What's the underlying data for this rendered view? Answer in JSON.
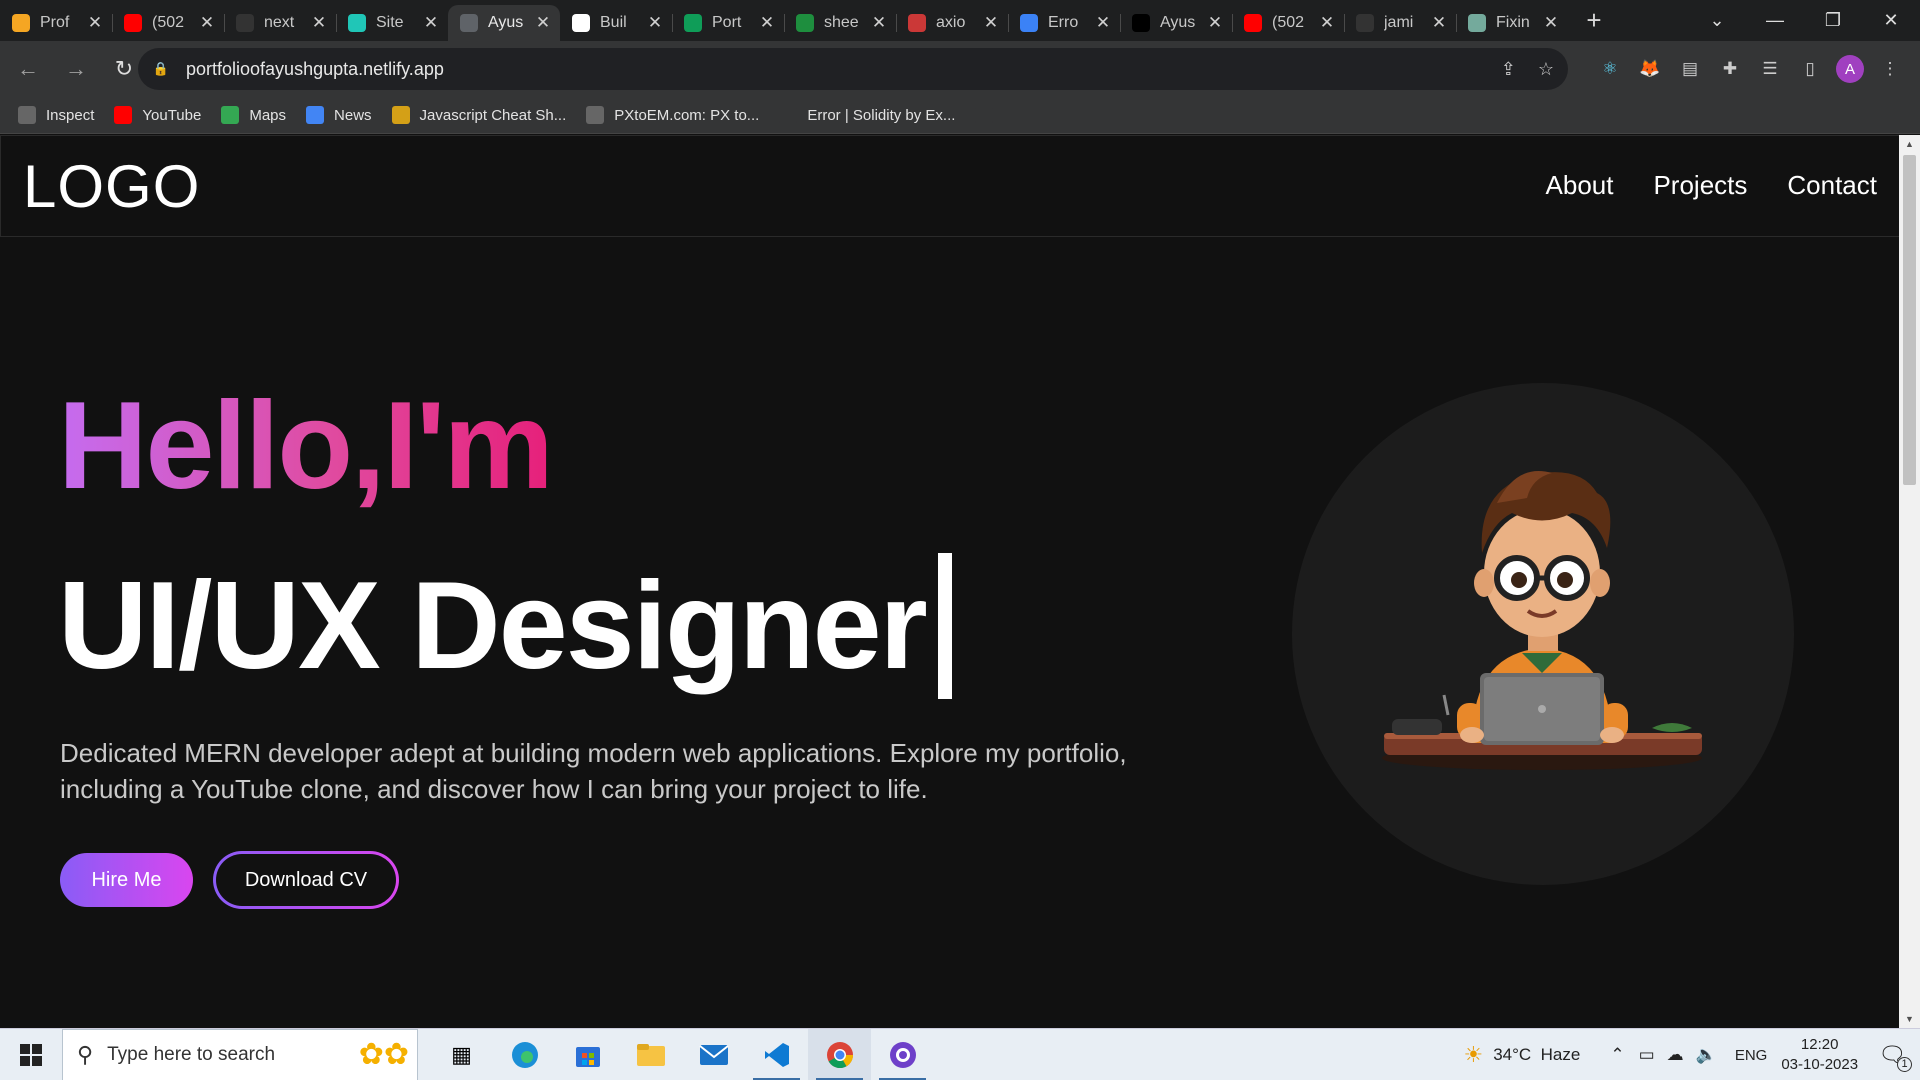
{
  "browser": {
    "tabs": [
      {
        "title": "Prof",
        "favicon": "app-icon",
        "color": "#f5a623"
      },
      {
        "title": "(502",
        "favicon": "youtube-icon",
        "color": "#ff0000"
      },
      {
        "title": "next",
        "favicon": "github-icon",
        "color": "#333333"
      },
      {
        "title": "Site",
        "favicon": "netlify-icon",
        "color": "#20c6b7"
      },
      {
        "title": "Ayus",
        "favicon": "globe-icon",
        "color": "#5f6368",
        "active": true
      },
      {
        "title": "Buil",
        "favicon": "google-icon",
        "color": "#ffffff"
      },
      {
        "title": "Port",
        "favicon": "sheets-icon",
        "color": "#0f9d58"
      },
      {
        "title": "shee",
        "favicon": "code-icon",
        "color": "#1e8e3e"
      },
      {
        "title": "axio",
        "favicon": "npm-icon",
        "color": "#cb3837"
      },
      {
        "title": "Erro",
        "favicon": "arrow-icon",
        "color": "#3b82f6"
      },
      {
        "title": "Ayus",
        "favicon": "vercel-icon",
        "color": "#000000"
      },
      {
        "title": "(502",
        "favicon": "youtube-icon",
        "color": "#ff0000"
      },
      {
        "title": "jami",
        "favicon": "github-icon",
        "color": "#333333"
      },
      {
        "title": "Fixin",
        "favicon": "chatgpt-icon",
        "color": "#74aa9c"
      }
    ],
    "url": "portfolioofayushgupta.netlify.app",
    "bookmarks": [
      {
        "label": "Inspect",
        "icon": "globe-icon",
        "color": "#666666"
      },
      {
        "label": "YouTube",
        "icon": "youtube-icon",
        "color": "#ff0000"
      },
      {
        "label": "Maps",
        "icon": "maps-icon",
        "color": "#34a853"
      },
      {
        "label": "News",
        "icon": "news-icon",
        "color": "#4285f4"
      },
      {
        "label": "Javascript Cheat Sh...",
        "icon": "bars-icon",
        "color": "#d4a017"
      },
      {
        "label": "PXtoEM.com: PX to...",
        "icon": "globe-icon",
        "color": "#666666"
      },
      {
        "label": "Error | Solidity by Ex...",
        "icon": "blank-icon",
        "color": "#343536"
      },
      {
        "label": "",
        "icon": "github-icon",
        "color": "#343536"
      }
    ]
  },
  "site": {
    "logo": "LOGO",
    "nav": [
      "About",
      "Projects",
      "Contact"
    ],
    "greeting": "Hello,I'm",
    "role": "UI/UX Designer",
    "description": "Dedicated MERN developer adept at building modern web applications. Explore my portfolio, including a YouTube clone, and discover how I can bring your project to life.",
    "hire_label": "Hire Me",
    "cv_label": "Download CV"
  },
  "taskbar": {
    "search_placeholder": "Type here to search",
    "weather": "34°C  Haze",
    "language": "ENG",
    "time": "12:20",
    "date": "03-10-2023",
    "notification_count": "1"
  }
}
